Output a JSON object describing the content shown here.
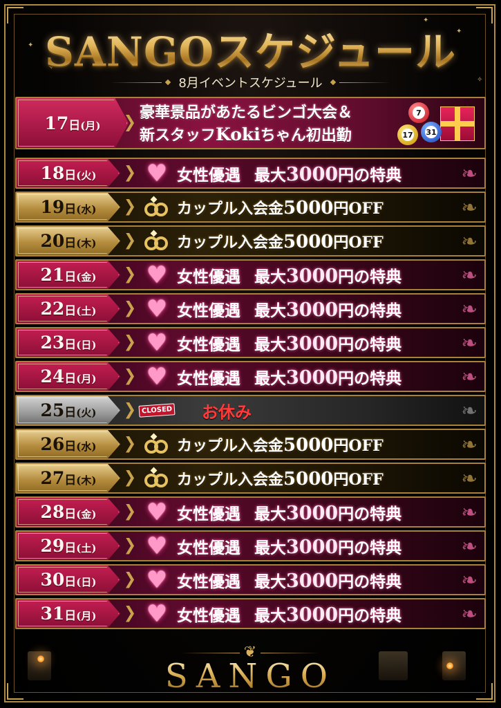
{
  "header": {
    "title": "SANGOスケジュール",
    "subtitle": "8月イベントスケジュール"
  },
  "event": {
    "date": "17",
    "unit": "日",
    "dow": "(月)",
    "line1": "豪華景品があたるビンゴ大会＆",
    "line2_pre": "新スタッフ",
    "line2_name": "Koki",
    "line2_post": "ちゃん初出勤",
    "bingo_balls": [
      "7",
      "17",
      "31"
    ]
  },
  "labels": {
    "women_pre": "女性優遇",
    "women_max": "最大",
    "women_amt": "3000",
    "women_post": "円の特典",
    "couple_pre": "カップル入会金",
    "couple_amt": "5000",
    "couple_post": "円OFF",
    "closed_badge": "CLOSED",
    "closed_text": "お休み"
  },
  "rows": [
    {
      "date": "18",
      "dow": "(火)",
      "type": "women"
    },
    {
      "date": "19",
      "dow": "(水)",
      "type": "couple"
    },
    {
      "date": "20",
      "dow": "(木)",
      "type": "couple"
    },
    {
      "date": "21",
      "dow": "(金)",
      "type": "women"
    },
    {
      "date": "22",
      "dow": "(土)",
      "type": "women"
    },
    {
      "date": "23",
      "dow": "(日)",
      "type": "women"
    },
    {
      "date": "24",
      "dow": "(月)",
      "type": "women"
    },
    {
      "date": "25",
      "dow": "(火)",
      "type": "closed"
    },
    {
      "date": "26",
      "dow": "(水)",
      "type": "couple"
    },
    {
      "date": "27",
      "dow": "(木)",
      "type": "couple"
    },
    {
      "date": "28",
      "dow": "(金)",
      "type": "women"
    },
    {
      "date": "29",
      "dow": "(土)",
      "type": "women"
    },
    {
      "date": "30",
      "dow": "(日)",
      "type": "women"
    },
    {
      "date": "31",
      "dow": "(月)",
      "type": "women"
    }
  ],
  "day_unit": "日",
  "footer": {
    "brand": "SANGO"
  },
  "colors": {
    "gold": "#c9a24d",
    "women_row": "#5c0a2c",
    "couple_row": "#2c2108",
    "closed_row": "#3b3b3b",
    "closed_text": "#ff3a3a"
  }
}
